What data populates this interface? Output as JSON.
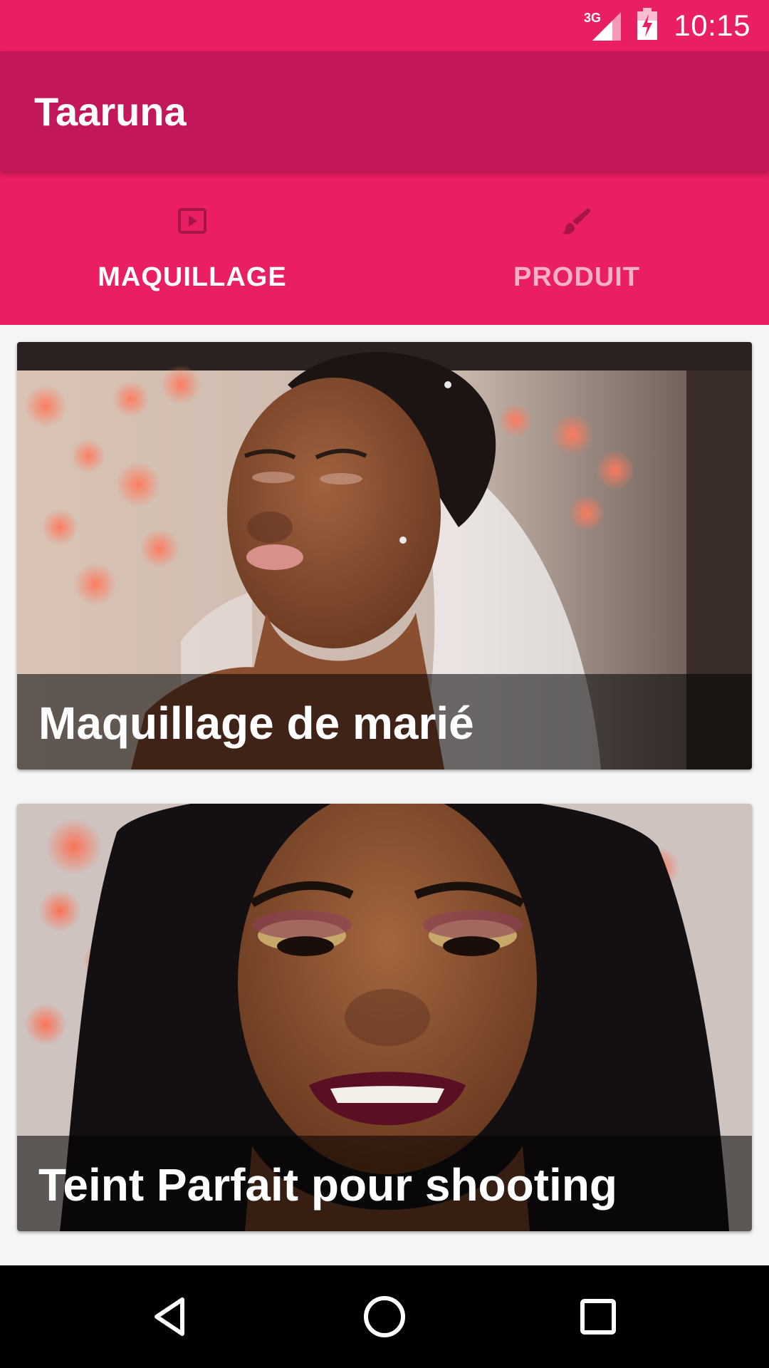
{
  "status_bar": {
    "network": "3G",
    "time": "10:15",
    "icons": [
      "signal-3g-icon",
      "battery-charging-icon"
    ]
  },
  "app_bar": {
    "title": "Taaruna"
  },
  "tabs": [
    {
      "label": "MAQUILLAGE",
      "icon": "play-video-icon",
      "active": true
    },
    {
      "label": "PRODUIT",
      "icon": "brush-icon",
      "active": false
    }
  ],
  "cards": [
    {
      "title": "Maquillage de marié",
      "image": "bridal-makeup-photo"
    },
    {
      "title": "Teint Parfait pour shooting",
      "image": "perfect-complexion-photo"
    }
  ],
  "nav_bar": {
    "buttons": [
      "back-icon",
      "home-icon",
      "recents-icon"
    ]
  },
  "colors": {
    "primary": "#e91e63",
    "primary_dark": "#c2185b",
    "nav": "#000000"
  }
}
